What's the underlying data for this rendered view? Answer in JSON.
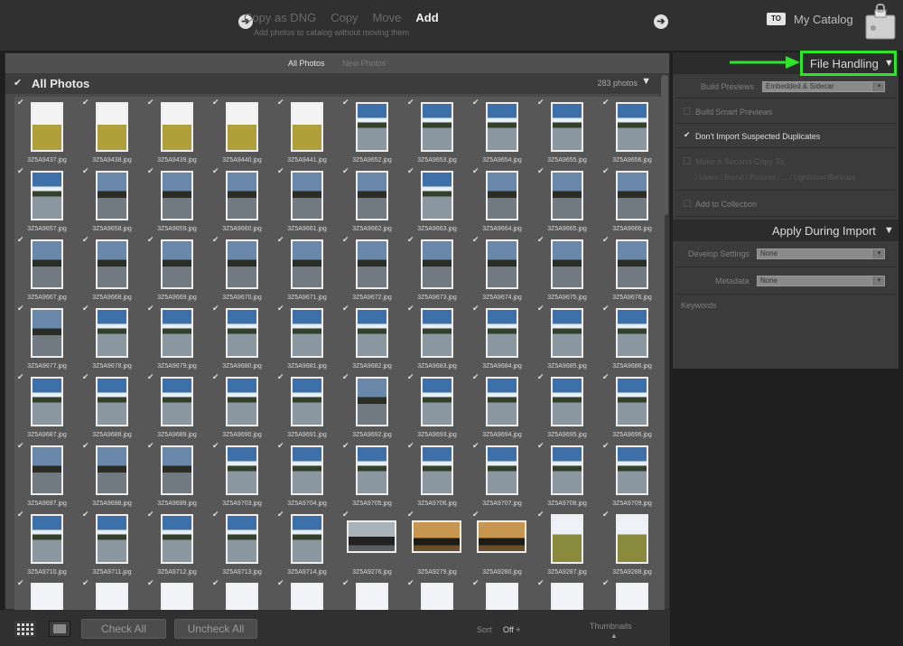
{
  "topbar": {
    "modes": [
      "Copy as DNG",
      "Copy",
      "Move",
      "Add"
    ],
    "active_mode": "Add",
    "subtitle": "Add photos to catalog without moving them",
    "catalog_badge": "TO",
    "catalog_name": "My Catalog"
  },
  "grid": {
    "tabs": [
      "All Photos",
      "New Photos"
    ],
    "header_title": "All Photos",
    "photo_count": "283 photos",
    "files": [
      "3Z5A9437.jpg",
      "3Z5A9438.jpg",
      "3Z5A9439.jpg",
      "3Z5A9440.jpg",
      "3Z5A9441.jpg",
      "3Z5A9652.jpg",
      "3Z5A9653.jpg",
      "3Z5A9654.jpg",
      "3Z5A9655.jpg",
      "3Z5A9656.jpg",
      "3Z5A9657.jpg",
      "3Z5A9658.jpg",
      "3Z5A9659.jpg",
      "3Z5A9660.jpg",
      "3Z5A9661.jpg",
      "3Z5A9662.jpg",
      "3Z5A9663.jpg",
      "3Z5A9664.jpg",
      "3Z5A9665.jpg",
      "3Z5A9666.jpg",
      "3Z5A9667.jpg",
      "3Z5A9668.jpg",
      "3Z5A9669.jpg",
      "3Z5A9670.jpg",
      "3Z5A9671.jpg",
      "3Z5A9672.jpg",
      "3Z5A9673.jpg",
      "3Z5A9674.jpg",
      "3Z5A9675.jpg",
      "3Z5A9676.jpg",
      "3Z5A9677.jpg",
      "3Z5A9678.jpg",
      "3Z5A9679.jpg",
      "3Z5A9680.jpg",
      "3Z5A9681.jpg",
      "3Z5A9682.jpg",
      "3Z5A9683.jpg",
      "3Z5A9684.jpg",
      "3Z5A9685.jpg",
      "3Z5A9686.jpg",
      "3Z5A9687.jpg",
      "3Z5A9688.jpg",
      "3Z5A9689.jpg",
      "3Z5A9690.jpg",
      "3Z5A9691.jpg",
      "3Z5A9692.jpg",
      "3Z5A9693.jpg",
      "3Z5A9694.jpg",
      "3Z5A9695.jpg",
      "3Z5A9696.jpg",
      "3Z5A9697.jpg",
      "3Z5A9698.jpg",
      "3Z5A9699.jpg",
      "3Z5A9703.jpg",
      "3Z5A9704.jpg",
      "3Z5A9705.jpg",
      "3Z5A9706.jpg",
      "3Z5A9707.jpg",
      "3Z5A9708.jpg",
      "3Z5A9709.jpg",
      "3Z5A9710.jpg",
      "3Z5A9711.jpg",
      "3Z5A9712.jpg",
      "3Z5A9713.jpg",
      "3Z5A9714.jpg",
      "3Z5A9276.jpg",
      "3Z5A9279.jpg",
      "3Z5A9280.jpg",
      "3Z5A9287.jpg",
      "3Z5A9288.jpg"
    ]
  },
  "bottombar": {
    "check_all": "Check All",
    "uncheck_all": "Uncheck All",
    "sort_label": "Sort",
    "sort_value": "Off ÷",
    "thumbnails_label": "Thumbnails"
  },
  "file_handling": {
    "title": "File Handling",
    "build_previews_label": "Build Previews",
    "build_previews_value": "Embedded & Sidecar",
    "smart_previews": "Build Smart Previews",
    "dont_import_duplicates": "Don't Import Suspected Duplicates",
    "second_copy": "Make a Second Copy To:",
    "second_copy_path": "/ Users / Brend / Pictures / ... / Lightroom Backups",
    "add_to_collection": "Add to Collection"
  },
  "apply_during_import": {
    "title": "Apply During Import",
    "develop_label": "Develop Settings",
    "develop_value": "None",
    "metadata_label": "Metadata",
    "metadata_value": "None",
    "keywords_label": "Keywords"
  },
  "colors": {
    "highlight": "#2ee52a",
    "background": "#1f1f1f"
  }
}
